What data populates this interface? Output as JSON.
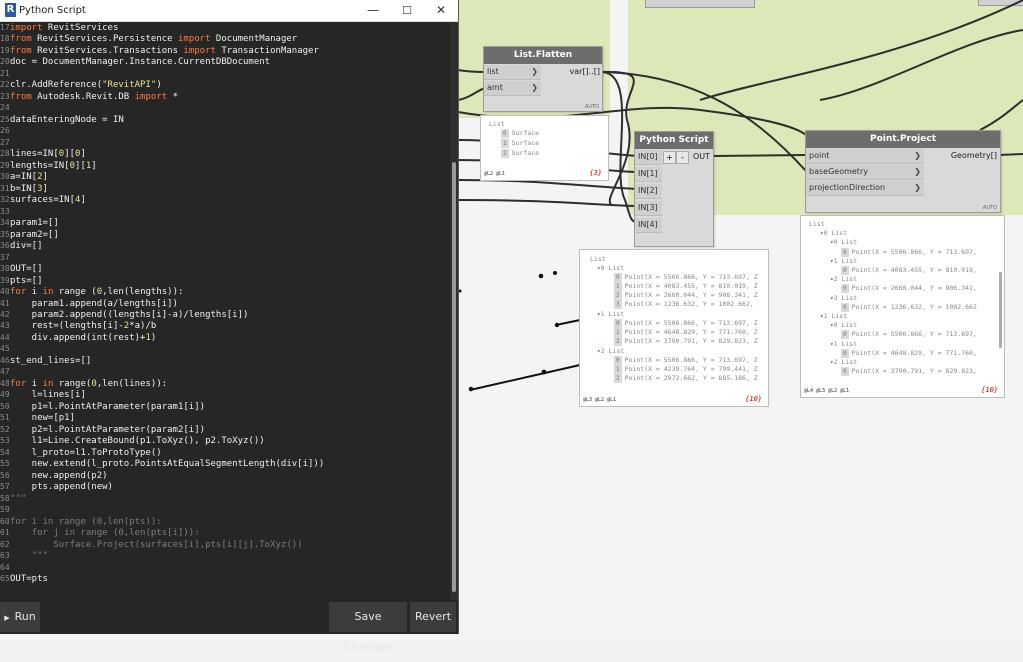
{
  "window": {
    "title": "Python Script",
    "minimize": "—",
    "maximize": "☐",
    "close": "✕"
  },
  "code_lines": [
    {
      "n": "17",
      "parts": [
        [
          "kw",
          "import"
        ],
        [
          "t",
          " RevitServices"
        ]
      ]
    },
    {
      "n": "18",
      "parts": [
        [
          "kw",
          "from"
        ],
        [
          "t",
          " RevitServices.Persistence "
        ],
        [
          "kw",
          "import"
        ],
        [
          "t",
          " DocumentManager"
        ]
      ]
    },
    {
      "n": "19",
      "parts": [
        [
          "kw",
          "from"
        ],
        [
          "t",
          " RevitServices.Transactions "
        ],
        [
          "kw",
          "import"
        ],
        [
          "t",
          " TransactionManager"
        ]
      ]
    },
    {
      "n": "20",
      "parts": [
        [
          "t",
          "doc = DocumentManager.Instance.CurrentDBDocument"
        ]
      ]
    },
    {
      "n": "21",
      "parts": []
    },
    {
      "n": "22",
      "parts": [
        [
          "t",
          "clr.AddReference("
        ],
        [
          "st",
          "\"RevitAPI\""
        ],
        [
          "t",
          ")"
        ]
      ]
    },
    {
      "n": "23",
      "parts": [
        [
          "kw",
          "from"
        ],
        [
          "t",
          " Autodesk.Revit.DB "
        ],
        [
          "kw",
          "import"
        ],
        [
          "t",
          " *"
        ]
      ]
    },
    {
      "n": "24",
      "parts": []
    },
    {
      "n": "25",
      "parts": [
        [
          "t",
          "dataEnteringNode = IN"
        ]
      ]
    },
    {
      "n": "26",
      "parts": []
    },
    {
      "n": "27",
      "parts": []
    },
    {
      "n": "28",
      "parts": [
        [
          "t",
          "lines=IN["
        ],
        [
          "st",
          "0"
        ],
        [
          "t",
          "]["
        ],
        [
          "st",
          "0"
        ],
        [
          "t",
          "]"
        ]
      ]
    },
    {
      "n": "29",
      "parts": [
        [
          "t",
          "lengths=IN["
        ],
        [
          "st",
          "0"
        ],
        [
          "t",
          "]["
        ],
        [
          "st",
          "1"
        ],
        [
          "t",
          "]"
        ]
      ]
    },
    {
      "n": "30",
      "parts": [
        [
          "t",
          "a=IN["
        ],
        [
          "st",
          "2"
        ],
        [
          "t",
          "]"
        ]
      ]
    },
    {
      "n": "31",
      "parts": [
        [
          "t",
          "b=IN["
        ],
        [
          "st",
          "3"
        ],
        [
          "t",
          "]"
        ]
      ]
    },
    {
      "n": "32",
      "parts": [
        [
          "t",
          "surfaces=IN["
        ],
        [
          "st",
          "4"
        ],
        [
          "t",
          "]"
        ]
      ]
    },
    {
      "n": "33",
      "parts": []
    },
    {
      "n": "34",
      "parts": [
        [
          "t",
          "param1=[]"
        ]
      ]
    },
    {
      "n": "35",
      "parts": [
        [
          "t",
          "param2=[]"
        ]
      ]
    },
    {
      "n": "36",
      "parts": [
        [
          "t",
          "div=[]"
        ]
      ]
    },
    {
      "n": "37",
      "parts": []
    },
    {
      "n": "38",
      "parts": [
        [
          "t",
          "OUT=[]"
        ]
      ]
    },
    {
      "n": "39",
      "parts": [
        [
          "t",
          "pts=[]"
        ]
      ]
    },
    {
      "n": "40",
      "parts": [
        [
          "kw",
          "for"
        ],
        [
          "t",
          " i "
        ],
        [
          "kw",
          "in"
        ],
        [
          "t",
          " range ("
        ],
        [
          "st",
          "0"
        ],
        [
          "t",
          ",len(lengths)):"
        ]
      ]
    },
    {
      "n": "41",
      "parts": [
        [
          "t",
          "    param1.append(a/lengths[i])"
        ]
      ]
    },
    {
      "n": "42",
      "parts": [
        [
          "t",
          "    param2.append((lengths[i]-a)/lengths[i])"
        ]
      ]
    },
    {
      "n": "43",
      "parts": [
        [
          "t",
          "    rest=(lengths[i]-"
        ],
        [
          "st",
          "2"
        ],
        [
          "t",
          "*a)/b"
        ]
      ]
    },
    {
      "n": "44",
      "parts": [
        [
          "t",
          "    div.append(int(rest)+"
        ],
        [
          "st",
          "1"
        ],
        [
          "t",
          ")"
        ]
      ]
    },
    {
      "n": "45",
      "parts": []
    },
    {
      "n": "46",
      "parts": [
        [
          "t",
          "st_end_lines=[]"
        ]
      ]
    },
    {
      "n": "47",
      "parts": []
    },
    {
      "n": "48",
      "parts": [
        [
          "kw",
          "for"
        ],
        [
          "t",
          " i "
        ],
        [
          "kw",
          "in"
        ],
        [
          "t",
          " range("
        ],
        [
          "st",
          "0"
        ],
        [
          "t",
          ",len(lines)):"
        ]
      ]
    },
    {
      "n": "49",
      "parts": [
        [
          "t",
          "    l=lines[i]"
        ]
      ]
    },
    {
      "n": "50",
      "parts": [
        [
          "t",
          "    p1=l.PointAtParameter(param1[i])"
        ]
      ]
    },
    {
      "n": "51",
      "parts": [
        [
          "t",
          "    new=[p1]"
        ]
      ]
    },
    {
      "n": "52",
      "parts": [
        [
          "t",
          "    p2=l.PointAtParameter(param2[i])"
        ]
      ]
    },
    {
      "n": "53",
      "parts": [
        [
          "t",
          "    l1=Line.CreateBound(p1.ToXyz(), p2.ToXyz())"
        ]
      ]
    },
    {
      "n": "54",
      "parts": [
        [
          "t",
          "    l_proto=l1.ToProtoType()"
        ]
      ]
    },
    {
      "n": "55",
      "parts": [
        [
          "t",
          "    new.extend(l_proto.PointsAtEqualSegmentLength(div[i]))"
        ]
      ]
    },
    {
      "n": "56",
      "parts": [
        [
          "t",
          "    new.append(p2)"
        ]
      ]
    },
    {
      "n": "57",
      "parts": [
        [
          "t",
          "    pts.append(new)"
        ]
      ]
    },
    {
      "n": "58",
      "parts": [
        [
          "cm",
          "\"\"\""
        ]
      ]
    },
    {
      "n": "59",
      "parts": []
    },
    {
      "n": "60",
      "parts": [
        [
          "cm",
          "for i in range (0,len(pts)):"
        ]
      ]
    },
    {
      "n": "61",
      "parts": [
        [
          "cm",
          "    for j in range (0,len(pts[i])):"
        ]
      ]
    },
    {
      "n": "62",
      "parts": [
        [
          "cm",
          "        Surface.Project(surfaces[i],pts[i][j].ToXyz())"
        ]
      ]
    },
    {
      "n": "63",
      "parts": [
        [
          "cm",
          "    \"\"\""
        ]
      ]
    },
    {
      "n": "64",
      "parts": []
    },
    {
      "n": "65",
      "parts": [
        [
          "t",
          "OUT=pts"
        ]
      ]
    }
  ],
  "buttons": {
    "run": "Run",
    "save": "Save Changes",
    "revert": "Revert"
  },
  "nodes": {
    "list_flatten": {
      "title": "List.Flatten",
      "inputs": [
        "list",
        "amt"
      ],
      "output": "var[]..[]",
      "auto": "AUTO"
    },
    "python_script": {
      "title": "Python Script",
      "inputs": [
        "IN[0]",
        "IN[1]",
        "IN[2]",
        "IN[3]",
        "IN[4]"
      ],
      "output": "OUT",
      "plus": "+",
      "minus": "-"
    },
    "point_project": {
      "title": "Point.Project",
      "inputs": [
        "point",
        "baseGeometry",
        "projectionDirection"
      ],
      "output": "Geometry[]",
      "auto": "AUTO"
    }
  },
  "preview_flatten": {
    "head": "List",
    "items": [
      {
        "i": "0",
        "v": "Surface"
      },
      {
        "i": "1",
        "v": "Surface"
      },
      {
        "i": "2",
        "v": "Surface"
      }
    ],
    "foot": "@L2 @L1",
    "count": "{3}"
  },
  "preview_python": {
    "head": "List",
    "groups": [
      {
        "label": "0 List",
        "items": [
          {
            "i": "0",
            "v": "Point(X = 5506.866, Y = 713.697, Z"
          },
          {
            "i": "1",
            "v": "Point(X = 4083.455, Y = 810.019, Z"
          },
          {
            "i": "2",
            "v": "Point(X = 2660.044, Y = 906.341, Z"
          },
          {
            "i": "3",
            "v": "Point(X = 1236.632, Y = 1002.662,"
          }
        ]
      },
      {
        "label": "1 List",
        "items": [
          {
            "i": "0",
            "v": "Point(X = 5506.866, Y = 713.697, Z"
          },
          {
            "i": "1",
            "v": "Point(X = 4648.829, Y = 771.760, Z"
          },
          {
            "i": "2",
            "v": "Point(X = 3790.791, Y = 829.823, Z"
          }
        ]
      },
      {
        "label": "2 List",
        "items": [
          {
            "i": "0",
            "v": "Point(X = 5506.866, Y = 713.697, Z"
          },
          {
            "i": "1",
            "v": "Point(X = 4239.764, Y = 799.441, Z"
          },
          {
            "i": "2",
            "v": "Point(X = 2972.662, Y = 885.186, Z"
          }
        ]
      }
    ],
    "foot": "@L3 @L2 @L1",
    "count": "{10}"
  },
  "preview_project": {
    "rows": [
      {
        "d": 0,
        "tw": "",
        "t": "List"
      },
      {
        "d": 1,
        "tw": "▾",
        "t": "0 List"
      },
      {
        "d": 2,
        "tw": "▾",
        "t": "0 List"
      },
      {
        "d": 3,
        "tw": "",
        "i": "0",
        "t": "Point(X = 5506.866, Y = 713.697,"
      },
      {
        "d": 2,
        "tw": "▾",
        "t": "1 List"
      },
      {
        "d": 3,
        "tw": "",
        "i": "0",
        "t": "Point(X = 4083.455, Y = 810.019,"
      },
      {
        "d": 2,
        "tw": "▾",
        "t": "2 List"
      },
      {
        "d": 3,
        "tw": "",
        "i": "0",
        "t": "Point(X = 2660.044, Y = 906.341,"
      },
      {
        "d": 2,
        "tw": "▾",
        "t": "3 List"
      },
      {
        "d": 3,
        "tw": "",
        "i": "0",
        "t": "Point(X = 1236.632, Y = 1002.662"
      },
      {
        "d": 1,
        "tw": "▾",
        "t": "1 List"
      },
      {
        "d": 2,
        "tw": "▾",
        "t": "0 List"
      },
      {
        "d": 3,
        "tw": "",
        "i": "0",
        "t": "Point(X = 5506.866, Y = 713.697,"
      },
      {
        "d": 2,
        "tw": "▾",
        "t": "1 List"
      },
      {
        "d": 3,
        "tw": "",
        "i": "0",
        "t": "Point(X = 4648.829, Y = 771.760,"
      },
      {
        "d": 2,
        "tw": "▾",
        "t": "2 List"
      },
      {
        "d": 3,
        "tw": "",
        "i": "0",
        "t": "Point(X = 3790.791, Y = 829.823,"
      }
    ],
    "foot": "@L4 @L3 @L2 @L1",
    "count": "{10}"
  },
  "colors": {
    "keyword": "#ff7a3a",
    "string": "#e9e48a",
    "comment": "#7d7d7d",
    "editor_bg": "#262626",
    "canvas_green": "#dce8b8"
  },
  "icons": {
    "app": "revit-logo-icon",
    "run": "play-icon"
  }
}
